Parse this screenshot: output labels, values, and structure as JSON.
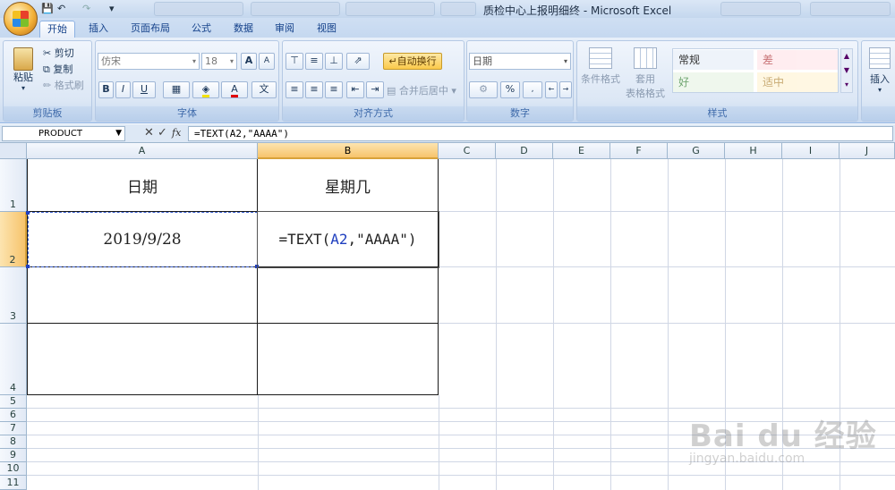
{
  "window": {
    "title": "质检中心上报明细终 - Microsoft Excel"
  },
  "tabs": [
    "开始",
    "插入",
    "页面布局",
    "公式",
    "数据",
    "审阅",
    "视图"
  ],
  "ribbon": {
    "clipboard": {
      "paste": "粘贴",
      "cut": "剪切",
      "copy": "复制",
      "format_painter": "格式刷",
      "label": "剪贴板"
    },
    "font": {
      "name": "仿宋",
      "size": "18",
      "bold": "B",
      "italic": "I",
      "underline": "U",
      "grow": "A",
      "shrink": "A",
      "label": "字体"
    },
    "alignment": {
      "wrap": "自动换行",
      "merge": "合并后居中",
      "label": "对齐方式"
    },
    "number": {
      "format": "日期",
      "percent": "%",
      "label": "数字"
    },
    "styles": {
      "conditional": "条件格式",
      "table_line1": "套用",
      "table_line2": "表格格式",
      "normal": "常规",
      "bad": "差",
      "good": "好",
      "neutral": "适中",
      "label": "样式"
    },
    "cells": {
      "insert": "插入"
    }
  },
  "formula_bar": {
    "name_box": "PRODUCT",
    "formula": "=TEXT(A2,\"AAAA\")",
    "fx": "fx"
  },
  "columns": [
    "A",
    "B",
    "C",
    "D",
    "E",
    "F",
    "G",
    "H",
    "I",
    "J"
  ],
  "rows": [
    "1",
    "2",
    "3",
    "4",
    "5",
    "6",
    "7",
    "8",
    "9",
    "10",
    "11"
  ],
  "cells": {
    "A1": "日期",
    "B1": "星期几",
    "A2": "2019/9/28",
    "B2_prefix": "=TEXT(",
    "B2_ref": "A2",
    "B2_suffix": ",\"AAAA\")"
  },
  "watermark": {
    "brand": "Bai du 经验",
    "url": "jingyan.baidu.com"
  }
}
